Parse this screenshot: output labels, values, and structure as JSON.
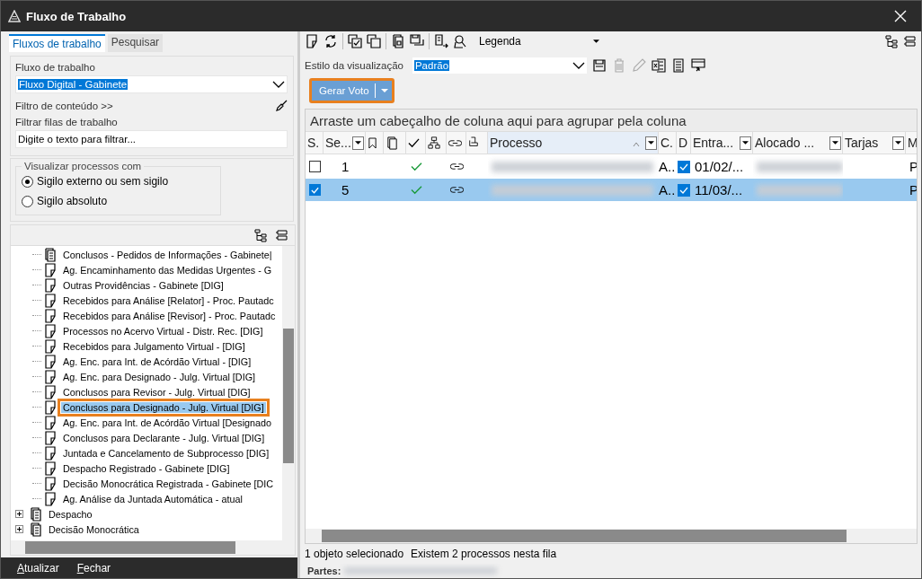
{
  "window": {
    "title": "Fluxo de Trabalho"
  },
  "left_tabs": [
    {
      "label": "Fluxos de trabalho",
      "selected": true
    },
    {
      "label": "Pesquisar",
      "selected": false
    }
  ],
  "workflow": {
    "label": "Fluxo de trabalho",
    "value": "Fluxo Digital - Gabinete",
    "content_filter": "Filtro de conteúdo >>",
    "queue_filter_label": "Filtrar filas de trabalho",
    "queue_filter_value": "Digite o texto para filtrar..."
  },
  "visibility": {
    "legend": "Visualizar processos com",
    "options": [
      {
        "label": "Sigilo externo ou sem sigilo",
        "selected": true
      },
      {
        "label": "Sigilo absoluto",
        "selected": false
      }
    ]
  },
  "tree": {
    "items": [
      {
        "children": [
          {
            "label": "Conclusos - Pedidos de Informações - Gabinete|",
            "kind": "stack",
            "selected": false
          },
          {
            "label": "Ag. Encaminhamento das Medidas Urgentes - G",
            "kind": "doc",
            "selected": false
          },
          {
            "label": "Outras Providências - Gabinete [DIG]",
            "kind": "doc",
            "selected": false
          },
          {
            "label": "Recebidos para Análise [Relator] - Proc. Pautadc",
            "kind": "doc",
            "selected": false
          },
          {
            "label": "Recebidos para Análise [Revisor] - Proc. Pautadc",
            "kind": "doc",
            "selected": false
          },
          {
            "label": "Processos no Acervo Virtual - Distr. Rec. [DIG]",
            "kind": "doc",
            "selected": false
          },
          {
            "label": "Recebidos para Julgamento Virtual - [DIG]",
            "kind": "doc",
            "selected": false
          },
          {
            "label": "Ag. Enc. para Int. de Acórdão Virtual - [DIG]",
            "kind": "doc",
            "selected": false
          },
          {
            "label": "Ag. Enc. para Designado - Julg. Virtual [DIG]",
            "kind": "doc",
            "selected": false
          },
          {
            "label": "Conclusos para Revisor - Julg. Virtual [DIG]",
            "kind": "doc",
            "selected": false
          },
          {
            "label": "Conclusos para Designado - Julg. Virtual [DIG]",
            "kind": "doc",
            "selected": true
          },
          {
            "label": "Ag. Enc. para Int. de Acórdão Virtual [Designado",
            "kind": "doc",
            "selected": false
          },
          {
            "label": "Conclusos para Declarante - Julg. Virtual [DIG]",
            "kind": "doc",
            "selected": false
          },
          {
            "label": "Juntada e Cancelamento de Subprocesso [DIG]",
            "kind": "doc",
            "selected": false
          },
          {
            "label": "Despacho Registrado - Gabinete [DIG]",
            "kind": "doc",
            "selected": false
          },
          {
            "label": "Decisão Monocrática Registrada - Gabinete [DIC",
            "kind": "doc",
            "selected": false
          },
          {
            "label": "Ag. Análise da Juntada Automática - atual",
            "kind": "doc",
            "selected": false
          }
        ]
      },
      {
        "label": "Despacho",
        "kind": "stack",
        "selected": false,
        "expanded": false
      },
      {
        "label": "Decisão Monocrática",
        "kind": "stack",
        "selected": false,
        "expanded": false
      }
    ]
  },
  "left_footer": {
    "buttons": [
      "Atualizar",
      "Fechar"
    ]
  },
  "toolbar": {
    "legend": "Legenda"
  },
  "view_style": {
    "label": "Estilo da visualização",
    "value": "Padrão"
  },
  "action_button": {
    "label": "Gerar Voto",
    "highlighted": true
  },
  "grid": {
    "group_hint": "Arraste um cabeçalho de coluna aqui para agrupar pela coluna",
    "columns": [
      {
        "kind": "text",
        "label": "S.",
        "filter": false,
        "sorted": false
      },
      {
        "kind": "text",
        "label": "Se...",
        "filter": true,
        "sorted": false
      },
      {
        "kind": "icon",
        "filter": false,
        "sorted": false
      },
      {
        "kind": "icon",
        "filter": false,
        "sorted": false
      },
      {
        "kind": "icon",
        "filter": false,
        "sorted": false
      },
      {
        "kind": "icon",
        "filter": false,
        "sorted": false
      },
      {
        "kind": "icon",
        "filter": false,
        "sorted": false
      },
      {
        "kind": "icon",
        "filter": false,
        "sorted": false
      },
      {
        "kind": "text",
        "label": "Processo",
        "filter": true,
        "sorted": true
      },
      {
        "kind": "text",
        "label": "C.",
        "filter": false,
        "sorted": false
      },
      {
        "kind": "text",
        "label": "D",
        "filter": false,
        "sorted": false
      },
      {
        "kind": "text",
        "label": "Entra...",
        "filter": true,
        "sorted": false
      },
      {
        "kind": "text",
        "label": "Alocado ...",
        "filter": true,
        "sorted": false
      },
      {
        "kind": "text",
        "label": "Tarjas",
        "filter": true,
        "sorted": false
      },
      {
        "kind": "text",
        "label": "M",
        "filter": false,
        "sorted": false
      }
    ],
    "rows": [
      {
        "checked": false,
        "selected": false,
        "seq": "1",
        "done": true,
        "linked": true,
        "c": "A..",
        "d_checked": true,
        "entrada": "01/02/...",
        "m": "P"
      },
      {
        "checked": true,
        "selected": true,
        "seq": "5",
        "done": true,
        "linked": true,
        "c": "A..",
        "d_checked": true,
        "entrada": "11/03/...",
        "m": "P"
      }
    ]
  },
  "status_bar": {
    "selection": "1 objeto selecionado",
    "count": "Existem 2 processos nesta fila",
    "parties_label": "Partes:"
  }
}
